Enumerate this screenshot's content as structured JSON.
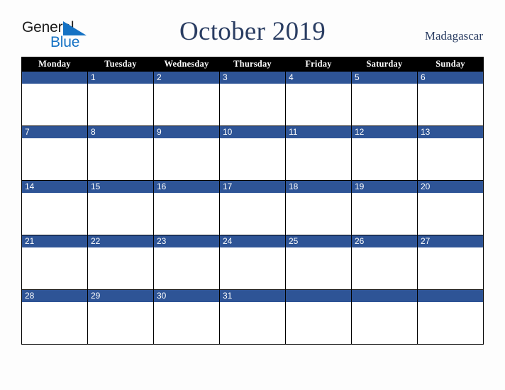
{
  "brand": {
    "line1": "General",
    "line2": "Blue",
    "triangle_color": "#1572c4",
    "line1_color": "#1c1c1c",
    "line2_color": "#1572c4"
  },
  "header": {
    "title": "October 2019",
    "country": "Madagascar",
    "title_color": "#2a3d62"
  },
  "calendar": {
    "weekday_headers": [
      "Monday",
      "Tuesday",
      "Wednesday",
      "Thursday",
      "Friday",
      "Saturday",
      "Sunday"
    ],
    "header_bg": "#000000",
    "header_text_color": "#ffffff",
    "daynum_bg": "#2e5496",
    "daynum_text_color": "#ffffff",
    "cell_bg": "#ffffff",
    "grid_color": "#000000",
    "weeks": [
      {
        "days": [
          "",
          "1",
          "2",
          "3",
          "4",
          "5",
          "6"
        ]
      },
      {
        "days": [
          "7",
          "8",
          "9",
          "10",
          "11",
          "12",
          "13"
        ]
      },
      {
        "days": [
          "14",
          "15",
          "16",
          "17",
          "18",
          "19",
          "20"
        ]
      },
      {
        "days": [
          "21",
          "22",
          "23",
          "24",
          "25",
          "26",
          "27"
        ]
      },
      {
        "days": [
          "28",
          "29",
          "30",
          "31",
          "",
          "",
          ""
        ]
      }
    ]
  },
  "page": {
    "background": "#fdfdfd"
  }
}
